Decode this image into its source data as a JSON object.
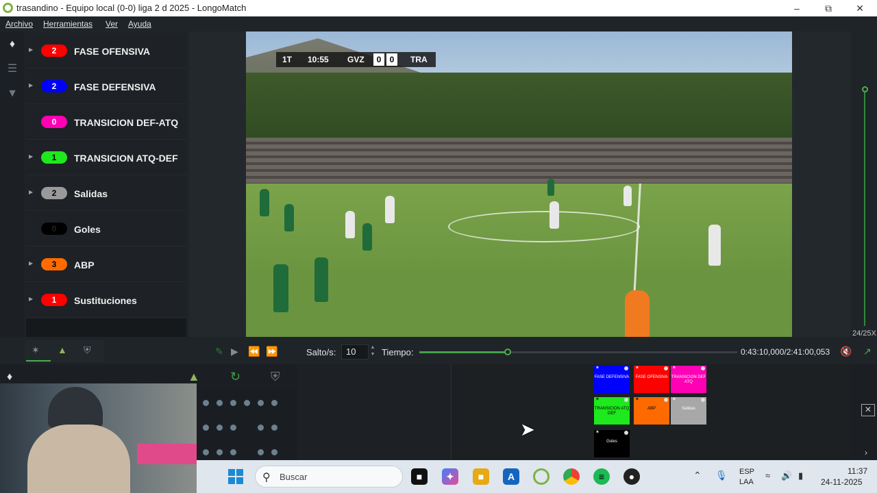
{
  "window": {
    "title": "trasandino - Equipo local (0-0) liga 2 d 2025 - LongoMatch",
    "minimize": "–",
    "maximize": "⧉",
    "close": "✕"
  },
  "menu": {
    "file": "Archivo",
    "tools": "Herramientas",
    "view": "Ver",
    "help": "Ayuda"
  },
  "categories": [
    {
      "label": "FASE OFENSIVA",
      "count": "2",
      "color": "#ff0000",
      "expandable": true
    },
    {
      "label": "FASE DEFENSIVA",
      "count": "2",
      "color": "#0000ff",
      "expandable": true
    },
    {
      "label": "TRANSICION DEF-ATQ",
      "count": "0",
      "color": "#ff00b4",
      "expandable": false
    },
    {
      "label": "TRANSICION ATQ-DEF",
      "count": "1",
      "color": "#1ee81e",
      "expandable": true
    },
    {
      "label": "Salidas",
      "count": "2",
      "color": "#9a9a9a",
      "expandable": true
    },
    {
      "label": "Goles",
      "count": "0",
      "color": "#000000",
      "expandable": false
    },
    {
      "label": "ABP",
      "count": "3",
      "color": "#ff6a00",
      "expandable": true
    },
    {
      "label": "Sustituciones",
      "count": "1",
      "color": "#ff0000",
      "expandable": true
    }
  ],
  "scoreboard": {
    "period": "1T",
    "clock": "10:55",
    "home": "GVZ",
    "home_score": "0",
    "away_score": "0",
    "away": "TRA"
  },
  "controls": {
    "jump_label": "Salto/s:",
    "jump_value": "10",
    "time_label": "Tiempo:",
    "time_readout": "0:43:10,000/2:41:00,053",
    "speed": "24/25X",
    "progress": 0.277
  },
  "dashboard_buttons": [
    {
      "label": "FASE DEFENSIVA",
      "color": "#0000ff"
    },
    {
      "label": "FASE OFENSIVA",
      "color": "#ff0000"
    },
    {
      "label": "TRANSICION DEF ATQ",
      "color": "#ff00b4"
    },
    {
      "label": "TRANSICION ATQ DEF",
      "color": "#1ee81e"
    },
    {
      "label": "ABP",
      "color": "#ff6a00"
    },
    {
      "label": "Salidas",
      "color": "#a8a8a8"
    },
    {
      "label": "Goles",
      "color": "#000000"
    }
  ],
  "taskbar": {
    "search_placeholder": "Buscar",
    "lang_1": "ESP",
    "lang_2": "LAA",
    "time": "11:37",
    "date": "24-11-2025"
  },
  "colors": {
    "accent": "#4caf50",
    "background": "#1f2428"
  }
}
